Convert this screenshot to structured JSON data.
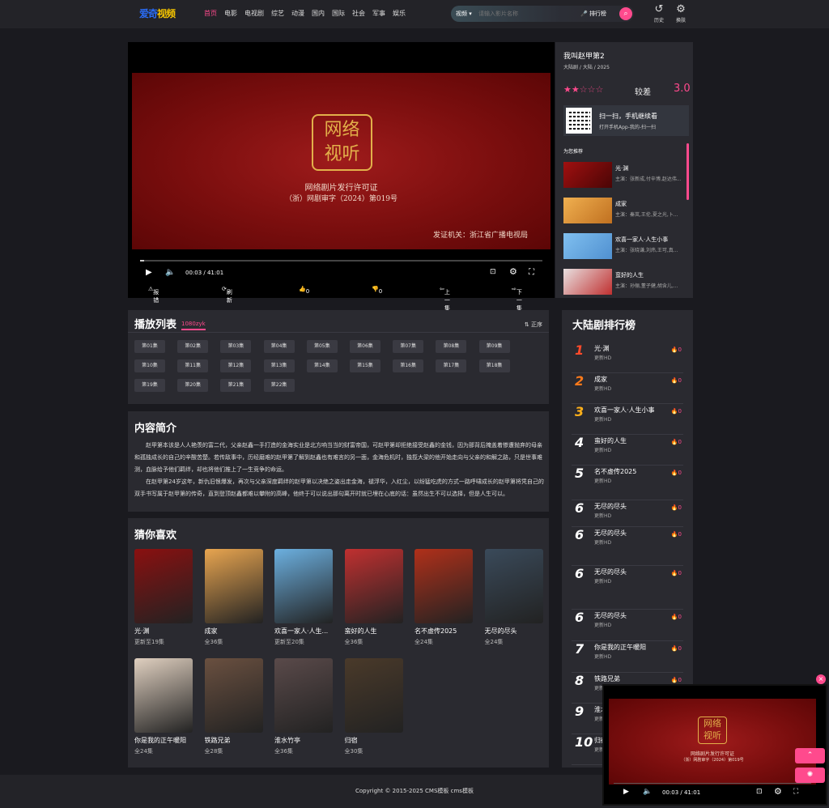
{
  "header": {
    "logo_a": "爱奇",
    "logo_b": "视频",
    "nav": [
      "首页",
      "电影",
      "电视剧",
      "综艺",
      "动漫",
      "国内",
      "国际",
      "社会",
      "军事",
      "娱乐"
    ],
    "search_type": "视频",
    "search_placeholder": "请输入影片名称",
    "rank_label": "排行榜",
    "history": "历史",
    "theme": "换肤",
    "accent": "#ff4a8d"
  },
  "player": {
    "seal_text": "网络视听",
    "license_title": "网络剧片发行许可证",
    "license_no": "（浙）网剧审字（2024）第019号",
    "issuer": "发证机关：浙江省广播电视局",
    "time": "00:03 / 41:01",
    "progress": 0.01,
    "actions": [
      "报错",
      "刷新",
      "0",
      "0",
      "上一集",
      "下一集"
    ]
  },
  "info": {
    "title": "我叫赵甲第2",
    "meta": "大陆剧 / 大陆 / 2025",
    "rating_stars": 2,
    "rating_text": "较差",
    "score": "3.0",
    "qr_title": "扫一扫，手机继续看",
    "qr_sub": "打开手机App-我的-扫一扫",
    "rec_title": "为您推荐",
    "recs": [
      {
        "name": "光·渊",
        "cast": "主演：张新成,付辛博,赵达伟..."
      },
      {
        "name": "成家",
        "cast": "主演：秦岚,王伦,夏之光,卜..."
      },
      {
        "name": "欢喜一家人·人生小事",
        "cast": "主演：张晓谦,刘炜,王可,真..."
      },
      {
        "name": "蛮好的人生",
        "cast": "主演：孙俪,董子健,胡含儿,..."
      }
    ]
  },
  "playlist": {
    "title": "播放列表",
    "source": "1080zyk",
    "order": "正序",
    "episodes": [
      "第01集",
      "第02集",
      "第03集",
      "第04集",
      "第05集",
      "第06集",
      "第07集",
      "第08集",
      "第09集",
      "第10集",
      "第11集",
      "第12集",
      "第13集",
      "第14集",
      "第15集",
      "第16集",
      "第17集",
      "第18集",
      "第19集",
      "第20集",
      "第21集",
      "第22集"
    ]
  },
  "intro": {
    "title": "内容简介",
    "p1": "赵甲第本该是人人艳羡的富二代，父亲赵鑫一手打造的金海实业是北方响当当的财富帝国，可赵甲第却拒绝接受赵鑫的金钱，因为那背后掩盖着惨遭抛弃的母亲和孤独成长的自己的辛酸苦楚。若传敌事中，历经磨难的赵甲第了解到赵鑫也有难言的另一面，金海危机时，独揽大梁的他开始走向与父亲的和解之路，只是世事难测，血脉给予他们羁绊，却也将他们推上了一生竞争的命运。",
    "p2": "在赵甲第24岁这年，新仇旧恨爆发，再次与父亲深度羁绊的赵甲第以决绝之姿出走金海，褪浮华，入红尘，以纷猛吃虎的方式一路呼啸成长的赵甲第将凭自己的双手书写属于赵甲第的传奇，直到登顶赵鑫都难以攀附的高峰，他终于可以说出那句离开时就已埋在心底的话：虽然出生不可以选择，但是人生可以。"
  },
  "guess": {
    "title": "猜你喜欢",
    "items": [
      {
        "name": "光·渊",
        "status": "更新至19集",
        "color": "#8a1010"
      },
      {
        "name": "成家",
        "status": "全36集",
        "color": "#e8a550"
      },
      {
        "name": "欢喜一家人·人生...",
        "status": "更新至20集",
        "color": "#6cb0e0"
      },
      {
        "name": "蛮好的人生",
        "status": "全36集",
        "color": "#c03030"
      },
      {
        "name": "名不虚传2025",
        "status": "全24集",
        "color": "#b0301a"
      },
      {
        "name": "无尽的尽头",
        "status": "全24集",
        "color": "#3a4a5a"
      },
      {
        "name": "你是我的正午暖阳",
        "status": "全24集",
        "color": "#e0d0c0"
      },
      {
        "name": "铁路兄弟",
        "status": "全28集",
        "color": "#6a5040"
      },
      {
        "name": "淮水竹亭",
        "status": "全36集",
        "color": "#5a4a4a"
      },
      {
        "name": "归宿",
        "status": "全30集",
        "color": "#4a3a2a"
      }
    ]
  },
  "ranking": {
    "title": "大陆剧排行榜",
    "items": [
      {
        "num": "1",
        "name": "光·渊",
        "upd": "更新HD",
        "hot": "0",
        "color": "#ff4a2a"
      },
      {
        "num": "2",
        "name": "成家",
        "upd": "更新HD",
        "hot": "0",
        "color": "#ff7a1a"
      },
      {
        "num": "3",
        "name": "欢喜一家人·人生小事",
        "upd": "更新HD",
        "hot": "0",
        "color": "#ffb01a"
      },
      {
        "num": "4",
        "name": "蛮好的人生",
        "upd": "更新HD",
        "hot": "0",
        "color": "#ffffff"
      },
      {
        "num": "5",
        "name": "名不虚传2025",
        "upd": "更新HD",
        "hot": "0",
        "color": "#ffffff"
      },
      {
        "num": "6",
        "name": "无尽的尽头",
        "upd": "更新HD",
        "hot": "0",
        "color": "#ffffff"
      },
      {
        "num": "6",
        "name": "无尽的尽头",
        "upd": "更新HD",
        "hot": "0",
        "color": "#ffffff"
      },
      {
        "num": "6",
        "name": "无尽的尽头",
        "upd": "更新HD",
        "hot": "0",
        "color": "#ffffff"
      },
      {
        "num": "6",
        "name": "无尽的尽头",
        "upd": "更新HD",
        "hot": "0",
        "color": "#ffffff"
      },
      {
        "num": "7",
        "name": "你是我的正午暖阳",
        "upd": "更新HD",
        "hot": "0",
        "color": "#ffffff"
      },
      {
        "num": "8",
        "name": "铁路兄弟",
        "upd": "更新HD",
        "hot": "0",
        "color": "#ffffff"
      },
      {
        "num": "9",
        "name": "淮水竹亭",
        "upd": "更新HD",
        "hot": "0",
        "color": "#ffffff"
      },
      {
        "num": "10",
        "name": "归宿",
        "upd": "更新HD",
        "hot": "0",
        "color": "#ffffff"
      }
    ]
  },
  "footer": "Copyright © 2015-2025 CMS模板 cms模板",
  "mini": {
    "time": "00:03 / 41:01"
  }
}
